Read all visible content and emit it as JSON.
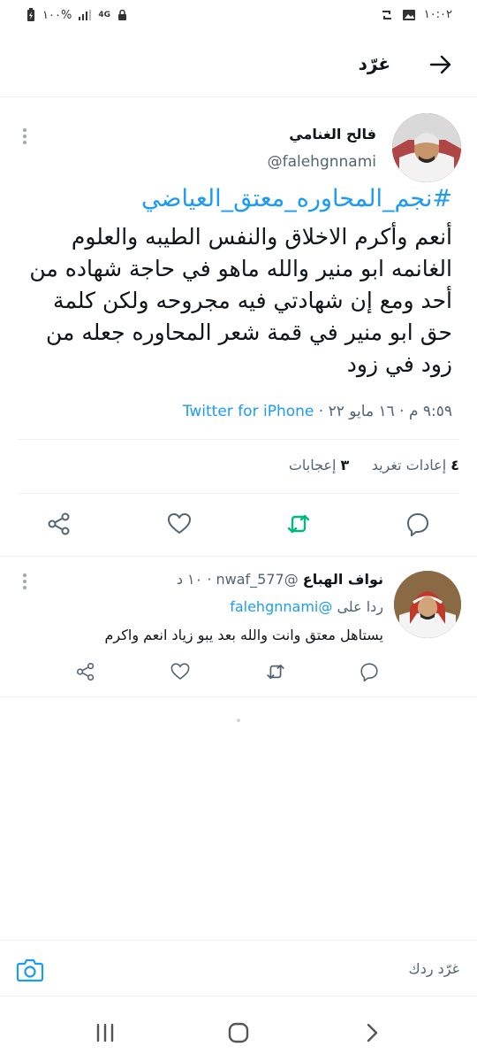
{
  "status_bar": {
    "time": "١٠:٠٢",
    "battery": "١٠٠%",
    "network": "4G"
  },
  "header": {
    "title": "غرّد"
  },
  "tweet": {
    "author_name": "فالح الغنامي",
    "author_handle": "@falehgnnami",
    "hashtag": "#نجم_المحاوره_معتق_العياضي",
    "body": "أنعم وأكرم الاخلاق والنفس الطيبه والعلوم الغانمه ابو منير والله ماهو في حاجة شهاده من أحد ومع إن شهادتي فيه مجروحه ولكن كلمة حق ابو منير في قمة شعر المحاوره جعله من زود في زود",
    "time": "٩:٥٩ م",
    "date": "١٦ مايو ٢٢",
    "separator": "·",
    "source": "Twitter for iPhone",
    "retweets_count": "٤",
    "retweets_label": "إعادات تغريد",
    "likes_count": "٣",
    "likes_label": "إعجابات"
  },
  "reply": {
    "name": "نواف الهباع",
    "handle": "@nwaf_577",
    "age": "١٠ د",
    "replying_to_label": "ردا على",
    "replying_to_handle": "@falehgnnami",
    "text": "يستاهل معتق وانت والله بعد يبو زياد انعم واكرم"
  },
  "composer": {
    "placeholder": "غرّد ردك"
  },
  "icons": {
    "back": "arrow-right-icon",
    "more": "more-vertical-icon",
    "share": "share-icon",
    "like": "heart-icon",
    "retweet": "retweet-icon",
    "reply": "reply-icon",
    "camera": "camera-icon",
    "nav_recents": "recents-icon",
    "nav_home": "home-icon",
    "nav_back": "back-chevron-icon"
  },
  "colors": {
    "accent": "#1d9bf0",
    "retweet_active": "#00ba7c",
    "muted": "#536471"
  }
}
